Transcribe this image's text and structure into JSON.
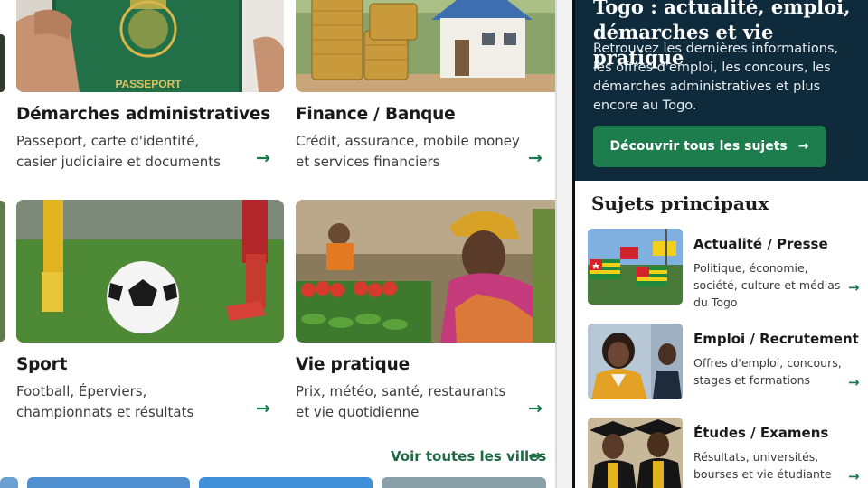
{
  "left": {
    "cards": [
      {
        "title": "Démarches administratives",
        "desc": "Passeport, carte d'identité, casier judiciaire et documents",
        "image": "passport-photo",
        "stamp": "PASSEPORT"
      },
      {
        "title": "Finance / Banque",
        "desc": "Crédit, assurance, mobile money et services financiers",
        "image": "coins-house-photo"
      },
      {
        "title": "Sport",
        "desc": "Football, Éperviers, championnats et résultats",
        "image": "football-photo"
      },
      {
        "title": "Vie pratique",
        "desc": "Prix, météo, santé, restaurants et vie quotidienne",
        "image": "market-photo"
      }
    ],
    "arrow_glyph": "→",
    "see_all_label": "Voir toutes les villes"
  },
  "right": {
    "hero": {
      "title": "Togo : actualité, emploi, démarches et vie pratique",
      "subtitle": "Retrouvez les dernières informations, les offres d'emploi, les concours, les démarches administratives et plus encore au Togo.",
      "cta_label": "Découvrir tous les sujets",
      "cta_arrow": "→"
    },
    "section_title": "Sujets principaux",
    "topics": [
      {
        "title": "Actualité / Presse",
        "desc": "Politique, économie, société, culture et médias du Togo",
        "image": "flags-photo"
      },
      {
        "title": "Emploi / Recrutement",
        "desc": "Offres d'emploi, concours, stages et formations",
        "image": "job-photo"
      },
      {
        "title": "Études / Examens",
        "desc": "Résultats, universités, bourses et vie étudiante",
        "image": "graduates-photo"
      }
    ]
  },
  "colors": {
    "accent_green": "#1e7d4d",
    "hero_navy": "#0f2a3a"
  }
}
